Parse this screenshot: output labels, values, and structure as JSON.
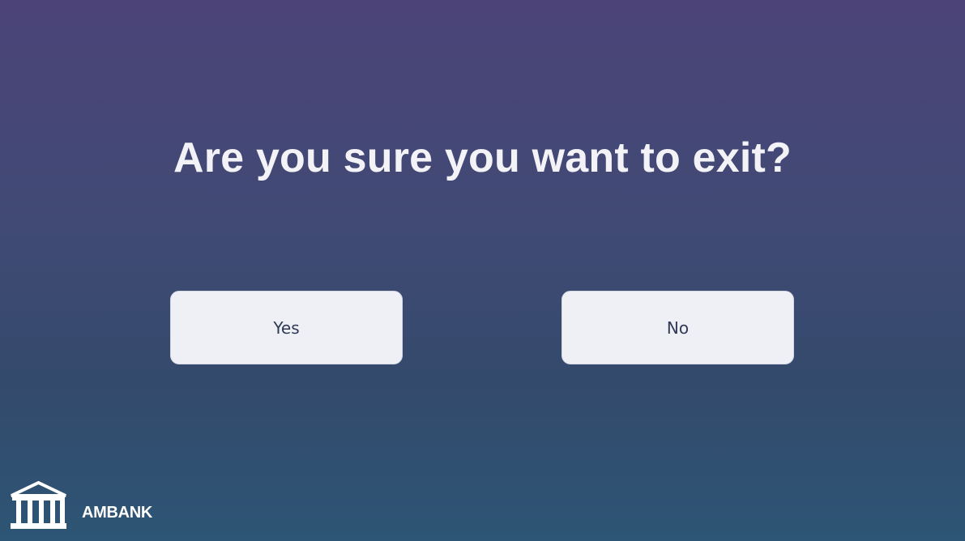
{
  "dialog": {
    "question": "Are you sure you want to exit?",
    "yes_label": "Yes",
    "no_label": "No"
  },
  "brand": {
    "name": "AMBANK",
    "icon": "bank-building-icon"
  },
  "colors": {
    "background_top": "#4c4478",
    "background_bottom": "#2d5575",
    "button_fill": "#eef0f5",
    "button_text": "#2f3a56",
    "heading_text": "#f2f2f7"
  }
}
